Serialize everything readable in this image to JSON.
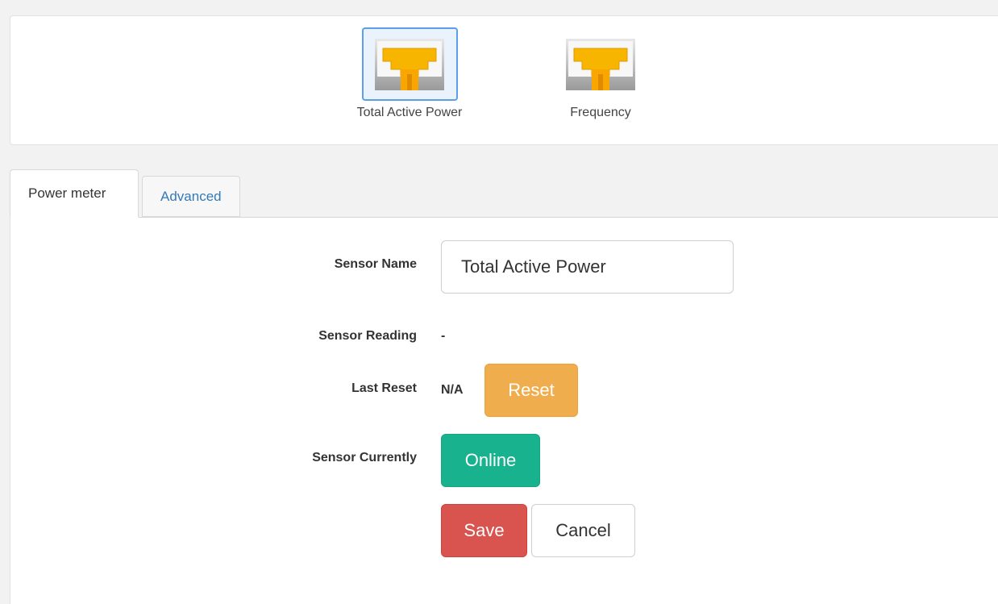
{
  "sensors": [
    {
      "label": "Total Active Power",
      "icon": "ethernet-port-icon",
      "selected": true
    },
    {
      "label": "Frequency",
      "icon": "ethernet-port-icon",
      "selected": false
    }
  ],
  "tabs": [
    {
      "label": "Power meter",
      "active": true
    },
    {
      "label": "Advanced",
      "active": false
    }
  ],
  "form": {
    "sensor_name_label": "Sensor Name",
    "sensor_name_value": "Total Active Power",
    "sensor_reading_label": "Sensor Reading",
    "sensor_reading_value": "-",
    "last_reset_label": "Last Reset",
    "last_reset_value": "N/A",
    "reset_button": "Reset",
    "sensor_currently_label": "Sensor Currently",
    "status_button": "Online",
    "save_button": "Save",
    "cancel_button": "Cancel"
  },
  "colors": {
    "reset": "#f0ad4e",
    "online": "#18b28f",
    "save": "#d9534f",
    "link": "#337ab7",
    "selected_border": "#5b9ee9",
    "port_yellow": "#f7b500"
  }
}
